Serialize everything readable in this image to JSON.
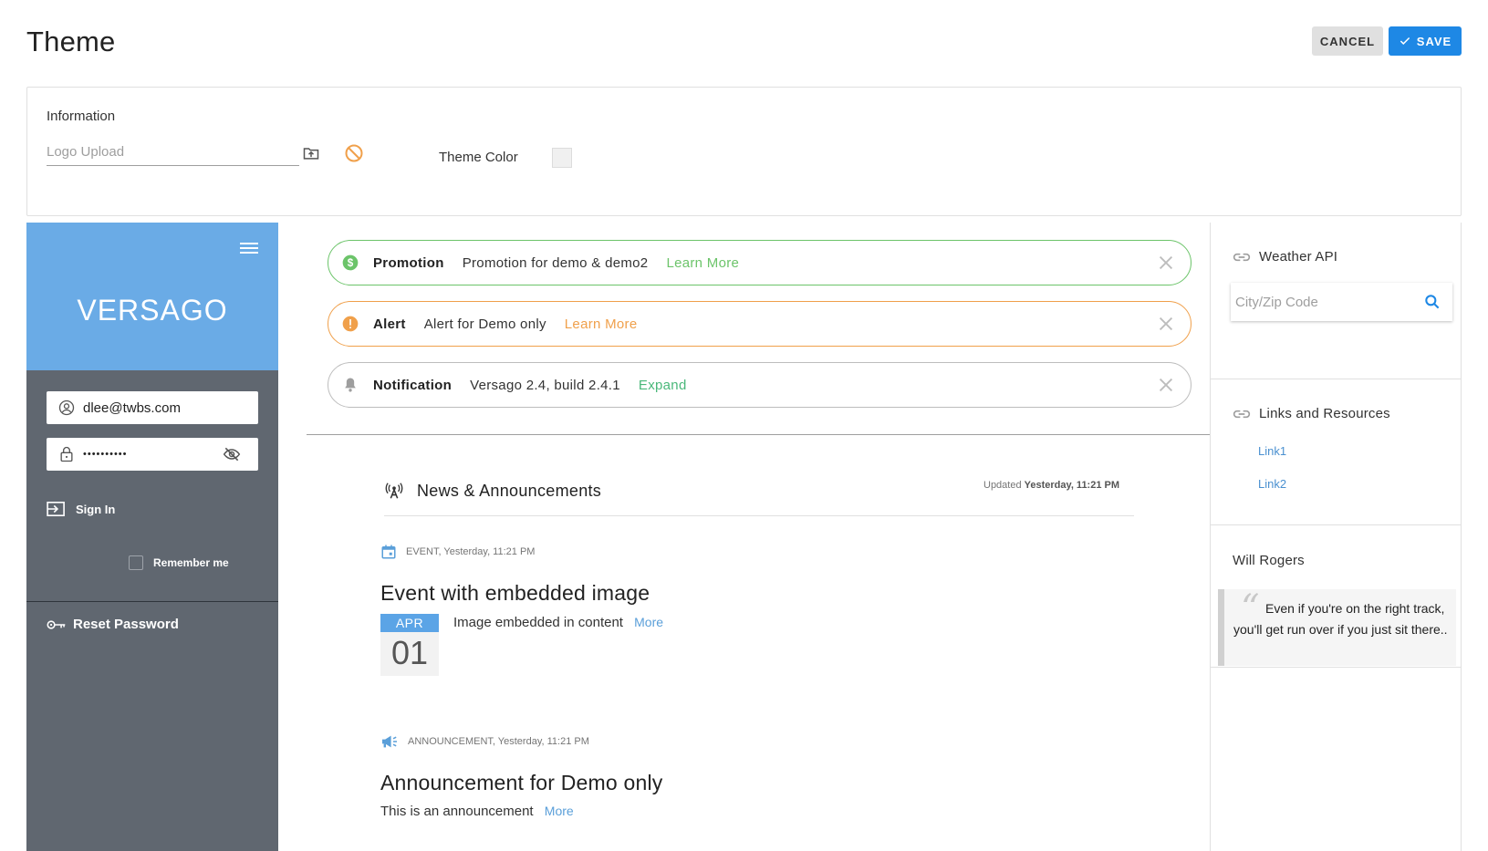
{
  "page": {
    "title": "Theme"
  },
  "toolbar": {
    "cancel_label": "CANCEL",
    "save_label": "SAVE"
  },
  "information": {
    "title": "Information",
    "logo_placeholder": "Logo Upload",
    "theme_color_label": "Theme Color",
    "theme_color_value": "#f0f0f0"
  },
  "sidebar": {
    "brand": "VERSAGO",
    "email": "dlee@twbs.com",
    "password_masked": "••••••••••",
    "sign_in_label": "Sign In",
    "remember_label": "Remember me",
    "reset_label": "Reset Password",
    "colors": {
      "header": "#6aabe6",
      "body": "#606770"
    }
  },
  "alerts": [
    {
      "icon": "dollar-circle-icon",
      "label": "Promotion",
      "message": "Promotion for demo & demo2",
      "link": "Learn More",
      "color": "#6cc46a"
    },
    {
      "icon": "warning-circle-icon",
      "label": "Alert",
      "message": "Alert for Demo only",
      "link": "Learn More",
      "color": "#f0a04b"
    },
    {
      "icon": "bell-icon",
      "label": "Notification",
      "message": "Versago 2.4, build 2.4.1",
      "link": "Expand",
      "color": "#bdbdbd"
    }
  ],
  "news": {
    "title": "News & Announcements",
    "updated_prefix": "Updated",
    "updated_value": "Yesterday, 11:21 PM",
    "posts": [
      {
        "meta": "EVENT, Yesterday, 11:21 PM",
        "title": "Event with embedded image",
        "date_month": "APR",
        "date_day": "01",
        "body": "Image embedded in content",
        "more": "More"
      },
      {
        "meta": "ANNOUNCEMENT, Yesterday, 11:21 PM",
        "title": "Announcement for Demo only",
        "body": "This is an announcement",
        "more": "More"
      }
    ]
  },
  "right": {
    "weather_title": "Weather API",
    "zip_placeholder": "City/Zip Code",
    "links_title": "Links and Resources",
    "links": [
      "Link1",
      "Link2"
    ],
    "quote_author": "Will Rogers",
    "quote_text": "Even if you're on the right track, you'll get run over if you just sit there.."
  }
}
